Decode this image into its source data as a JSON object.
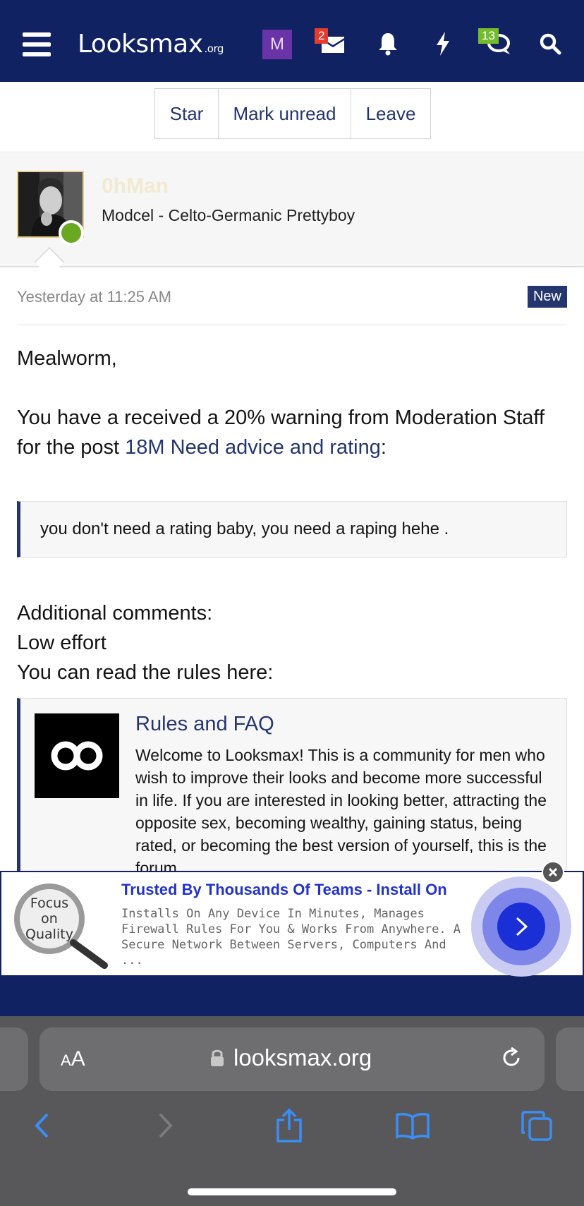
{
  "nav": {
    "logo_main": "Looksmax",
    "logo_suffix": ".org",
    "account_initial": "M",
    "inbox_count": "2",
    "conversations_count": "13",
    "colors": {
      "bar": "#102262",
      "accent": "#25366e"
    }
  },
  "actions": {
    "star": "Star",
    "mark_unread": "Mark unread",
    "leave": "Leave"
  },
  "author": {
    "name": "0hMan",
    "title": "Modcel - Celto-Germanic Prettyboy",
    "status": "online"
  },
  "message": {
    "timestamp": "Yesterday at 11:25 AM",
    "new_label": "New",
    "greeting": "Mealworm,",
    "warning_prefix": "You have a received a 20% warning from Moderation Staff for the post ",
    "post_link": "18M Need advice and rating",
    "warning_suffix": ":",
    "quote": "you don't need a rating baby, you need a raping hehe .",
    "additional_label": "Additional comments:",
    "comment": "Low effort",
    "rules_intro": "You can read the rules here:",
    "unfurl": {
      "title": "Rules and FAQ",
      "description": "Welcome to Looksmax! This is a community for men who wish to improve their looks and become more successful in life. If you are interested in looking better, attracting the opposite sex, becoming wealthy, gaining status, being rated, or becoming the best version of yourself, this is the forum."
    }
  },
  "ad": {
    "image_text": "Focus on Quality",
    "title": "Trusted By Thousands Of Teams - Install On",
    "description": "Installs On Any Device In Minutes, Manages Firewall Rules For You & Works From Anywhere. A Secure Network Between Servers, Computers And ..."
  },
  "browser": {
    "text_size_label": "AA",
    "url": "looksmax.org"
  }
}
